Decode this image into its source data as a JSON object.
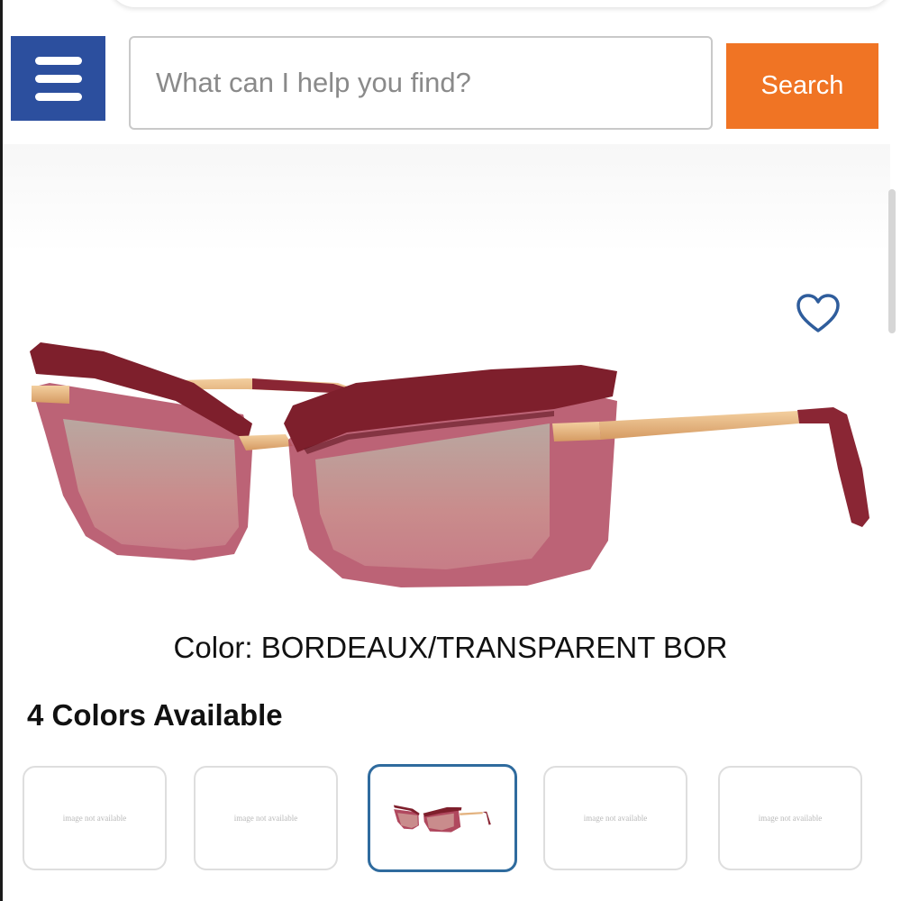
{
  "header": {
    "menu_icon": "hamburger-menu-icon",
    "search": {
      "placeholder": "What can I help you find?",
      "value": ""
    },
    "search_button_label": "Search"
  },
  "product": {
    "favorite_icon": "heart-outline-icon",
    "image_description_icon": "sunglasses-image",
    "color_line": "Color: BORDEAUX/TRANSPARENT BOR",
    "colors_available_label": "4 Colors Available"
  },
  "swatches": [
    {
      "text": "image not available",
      "selected": false
    },
    {
      "text": "image not available",
      "selected": false
    },
    {
      "text": "",
      "selected": true
    },
    {
      "text": "image not available",
      "selected": false
    },
    {
      "text": "image not available",
      "selected": false
    }
  ],
  "colors": {
    "menu_blue": "#2c4f9e",
    "search_orange": "#f07424",
    "heart_blue": "#2f5d9c",
    "selected_border": "#2f6b9e",
    "frame_bordeaux": "#7e1f2c",
    "frame_transparent": "#b0485e",
    "temple_gold": "#e3b27f"
  }
}
